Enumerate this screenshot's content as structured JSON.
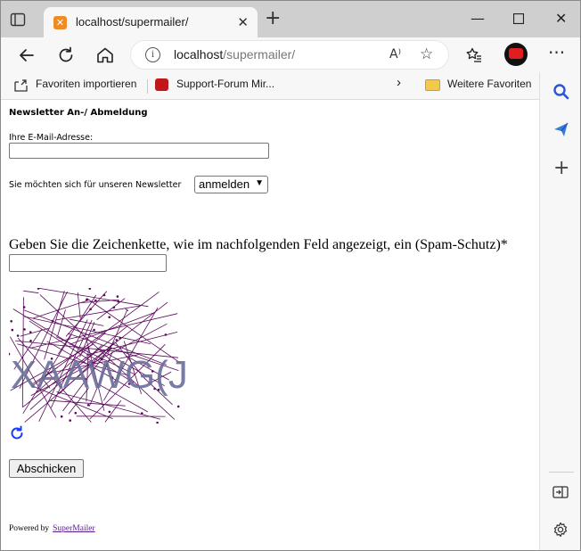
{
  "browser": {
    "tab_title": "localhost/supermailer/",
    "url_host": "localhost",
    "url_path": "/supermailer/",
    "read_aloud_label": "A⁾"
  },
  "favorites_bar": {
    "items": [
      "Favoriten importieren",
      "Support-Forum Mir..."
    ],
    "more_label": "Weitere Favoriten"
  },
  "page": {
    "title": "Newsletter An-/ Abmeldung",
    "email_label": "Ihre E-Mail-Adresse:",
    "email_value": "",
    "newsletter_label": "Sie möchten sich für unseren Newsletter",
    "newsletter_select": "anmelden",
    "captcha_prompt": "Geben Sie die Zeichenkette, wie im nachfolgenden Feld angezeigt, ein (Spam-Schutz)*",
    "captcha_value": "",
    "captcha_text": "XAAWG(J",
    "submit_label": "Abschicken",
    "powered_by": "Powered by",
    "powered_link": "SuperMailer"
  },
  "colors": {
    "captcha_lines": "#5a0a5a",
    "captcha_text": "#6b6f9a",
    "link": "#551a8b",
    "refresh_icon": "#1a3aff"
  },
  "icons": [
    "tab-actions-icon",
    "back-icon",
    "reload-icon",
    "home-icon",
    "info-icon",
    "read-aloud-icon",
    "favorite-add-icon",
    "favorites-icon",
    "profile-avatar-icon",
    "more-icon",
    "import-icon",
    "folder-icon",
    "search-icon",
    "send-icon",
    "add-icon",
    "split-screen-icon",
    "settings-icon",
    "refresh-icon"
  ]
}
